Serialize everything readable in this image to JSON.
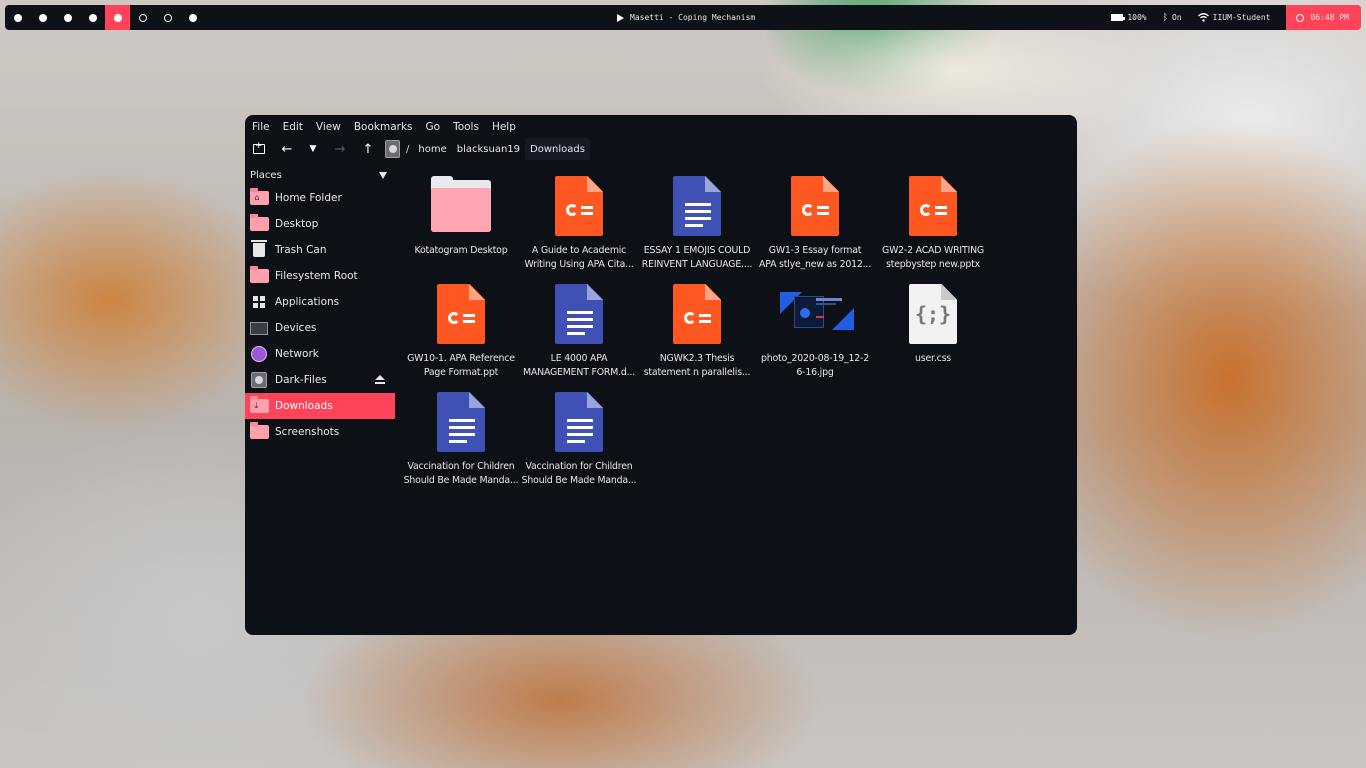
{
  "topbar": {
    "workspaces": [
      "filled",
      "filled",
      "filled",
      "filled",
      "active",
      "empty",
      "empty",
      "filled"
    ],
    "now_playing": "Masetti - Coping Mechanism",
    "battery": "100%",
    "bluetooth": "On",
    "wifi": "IIUM-Student",
    "clock": "06:48 PM",
    "accent": "#ff4358"
  },
  "window": {
    "menu": [
      "File",
      "Edit",
      "View",
      "Bookmarks",
      "Go",
      "Tools",
      "Help"
    ],
    "breadcrumb": {
      "separator": "/",
      "parts": [
        "home",
        "blacksuan19",
        "Downloads"
      ]
    }
  },
  "sidebar": {
    "header": "Places",
    "items": [
      {
        "label": "Home Folder",
        "icon": "home-folder-icon"
      },
      {
        "label": "Desktop",
        "icon": "desktop-folder-icon"
      },
      {
        "label": "Trash Can",
        "icon": "trash-icon"
      },
      {
        "label": "Filesystem Root",
        "icon": "root-folder-icon"
      },
      {
        "label": "Applications",
        "icon": "applications-icon"
      },
      {
        "label": "Devices",
        "icon": "monitor-icon"
      },
      {
        "label": "Network",
        "icon": "network-icon"
      },
      {
        "label": "Dark-Files",
        "icon": "drive-icon"
      },
      {
        "label": "Downloads",
        "icon": "downloads-folder-icon",
        "active": true
      },
      {
        "label": "Screenshots",
        "icon": "screenshots-folder-icon"
      }
    ]
  },
  "files": [
    {
      "line1": "Kotatogram Desktop",
      "line2": "",
      "type": "folder"
    },
    {
      "line1": "A Guide to Academic",
      "line2": "Writing Using APA Cita...",
      "type": "presentation"
    },
    {
      "line1": "ESSAY 1 EMOJIS COULD",
      "line2": "REINVENT LANGUAGE....",
      "type": "document"
    },
    {
      "line1": "GW1-3 Essay format",
      "line2": "APA stlye_new as 2012...",
      "type": "presentation"
    },
    {
      "line1": "GW2-2 ACAD WRITING",
      "line2": "stepbystep new.pptx",
      "type": "presentation"
    },
    {
      "line1": "GW10-1. APA Reference",
      "line2": "Page Format.ppt",
      "type": "presentation"
    },
    {
      "line1": "LE 4000 APA",
      "line2": "MANAGEMENT FORM.d...",
      "type": "document"
    },
    {
      "line1": "NGWK2.3 Thesis",
      "line2": "statement n parallelis...",
      "type": "presentation"
    },
    {
      "line1": "photo_2020-08-19_12-2",
      "line2": "6-16.jpg",
      "type": "image"
    },
    {
      "line1": "user.css",
      "line2": "",
      "type": "code"
    },
    {
      "line1": "Vaccination for Children",
      "line2": "Should Be Made Manda...",
      "type": "document"
    },
    {
      "line1": "Vaccination for Children",
      "line2": "Should Be Made Manda...",
      "type": "document"
    }
  ]
}
